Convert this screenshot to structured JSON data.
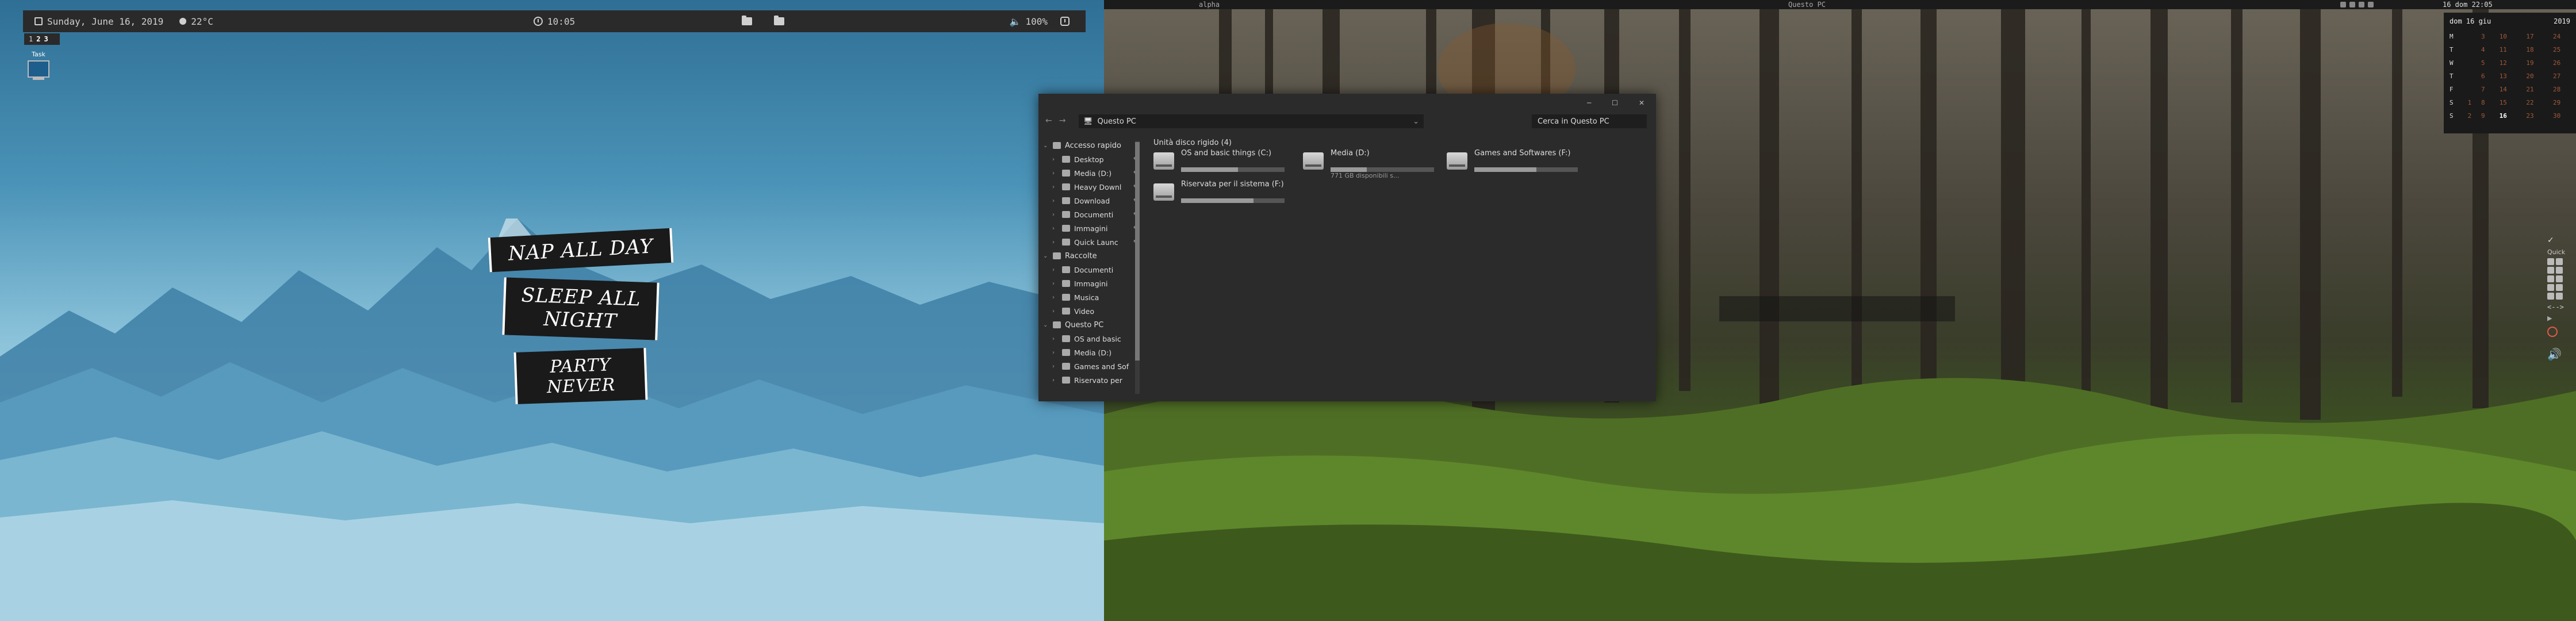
{
  "left_panel": {
    "date": "Sunday, June 16, 2019",
    "weather": "22°C",
    "time": "10:05",
    "volume": "100%",
    "workspaces": [
      "1",
      "2",
      "3"
    ],
    "task_label": "Task"
  },
  "wallpaper_left": {
    "lines": [
      "NAP ALL DAY",
      "SLEEP ALL NIGHT",
      "PARTY NEVER"
    ]
  },
  "right_panel": {
    "workspace_name": "alpha",
    "window_title": "Questo PC",
    "datetime": "16 dom 22:05"
  },
  "calendar": {
    "header_left": "dom 16 giu",
    "header_right": "2019",
    "rows": [
      {
        "day": "M",
        "dates": [
          "",
          "3",
          "10",
          "17",
          "24"
        ]
      },
      {
        "day": "T",
        "dates": [
          "",
          "4",
          "11",
          "18",
          "25"
        ]
      },
      {
        "day": "W",
        "dates": [
          "",
          "5",
          "12",
          "19",
          "26"
        ]
      },
      {
        "day": "T",
        "dates": [
          "",
          "6",
          "13",
          "20",
          "27"
        ]
      },
      {
        "day": "F",
        "dates": [
          "",
          "7",
          "14",
          "21",
          "28"
        ]
      },
      {
        "day": "S",
        "dates": [
          "1",
          "8",
          "15",
          "22",
          "29"
        ]
      },
      {
        "day": "S",
        "dates": [
          "2",
          "9",
          "16",
          "23",
          "30"
        ]
      }
    ]
  },
  "quick_dock": {
    "label": "Quick",
    "arrows": "<-->"
  },
  "explorer": {
    "address": "Questo PC",
    "search_placeholder": "Cerca in Questo PC",
    "sidebar": [
      {
        "label": "Accesso rapido",
        "group": true,
        "pin": false
      },
      {
        "label": "Desktop",
        "group": false,
        "pin": true
      },
      {
        "label": "Media (D:)",
        "group": false,
        "pin": true
      },
      {
        "label": "Heavy Downl",
        "group": false,
        "pin": true
      },
      {
        "label": "Download",
        "group": false,
        "pin": true
      },
      {
        "label": "Documenti",
        "group": false,
        "pin": true
      },
      {
        "label": "Immagini",
        "group": false,
        "pin": true
      },
      {
        "label": "Quick Launc",
        "group": false,
        "pin": true
      },
      {
        "label": "Raccolte",
        "group": true,
        "pin": false
      },
      {
        "label": "Documenti",
        "group": false,
        "pin": false
      },
      {
        "label": "Immagini",
        "group": false,
        "pin": false
      },
      {
        "label": "Musica",
        "group": false,
        "pin": false
      },
      {
        "label": "Video",
        "group": false,
        "pin": false
      },
      {
        "label": "Questo PC",
        "group": true,
        "pin": false
      },
      {
        "label": "OS and basic",
        "group": false,
        "pin": false
      },
      {
        "label": "Media (D:)",
        "group": false,
        "pin": false
      },
      {
        "label": "Games and Sof",
        "group": false,
        "pin": false
      },
      {
        "label": "Riservato per",
        "group": false,
        "pin": false
      }
    ],
    "group_header": "Unità disco rigido (4)",
    "drives": [
      {
        "name": "OS and basic things (C:)",
        "used": 0.55,
        "free": ""
      },
      {
        "name": "Media (D:)",
        "used": 0.35,
        "free": "771 GB disponibili s..."
      },
      {
        "name": "Games and Softwares (F:)",
        "used": 0.6,
        "free": ""
      },
      {
        "name": "Riservata per il sistema (F:)",
        "used": 0.7,
        "free": ""
      }
    ]
  }
}
